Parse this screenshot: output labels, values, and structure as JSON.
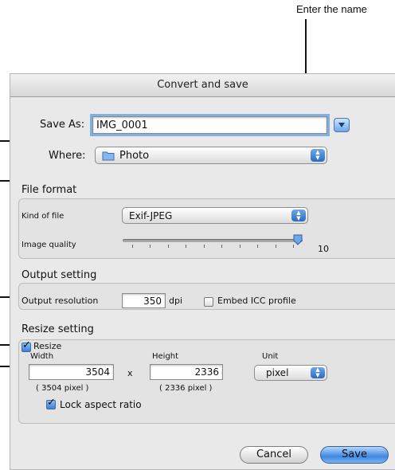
{
  "caption": "Enter the name",
  "dialog": {
    "title": "Convert and save",
    "save_as_label": "Save As:",
    "save_as_value": "IMG_0001",
    "where_label": "Where:",
    "where_value": "Photo",
    "file_format": {
      "title": "File format",
      "kind_label": "Kind of file",
      "kind_value": "Exif-JPEG",
      "quality_label": "Image quality",
      "quality_value": "10",
      "quality_fraction": 1.0
    },
    "output": {
      "title": "Output setting",
      "resolution_label": "Output resolution",
      "resolution_value": "350",
      "resolution_unit": "dpi",
      "embed_icc_label": "Embed ICC profile",
      "embed_icc_checked": false
    },
    "resize": {
      "title": "Resize setting",
      "resize_label": "Resize",
      "resize_checked": true,
      "width_label": "Width",
      "width_value": "3504",
      "width_note": "( 3504 pixel )",
      "times": "x",
      "height_label": "Height",
      "height_value": "2336",
      "height_note": "( 2336 pixel )",
      "unit_label": "Unit",
      "unit_value": "pixel",
      "lock_label": "Lock aspect ratio",
      "lock_checked": true
    },
    "cancel_label": "Cancel",
    "save_label": "Save"
  },
  "icons": {
    "folder": "folder-icon",
    "disclosure": "disclosure-triangle-icon",
    "popup": "popup-arrows-icon"
  },
  "colors": {
    "accent": "#3e88e0",
    "focus": "#7fb0e3"
  }
}
